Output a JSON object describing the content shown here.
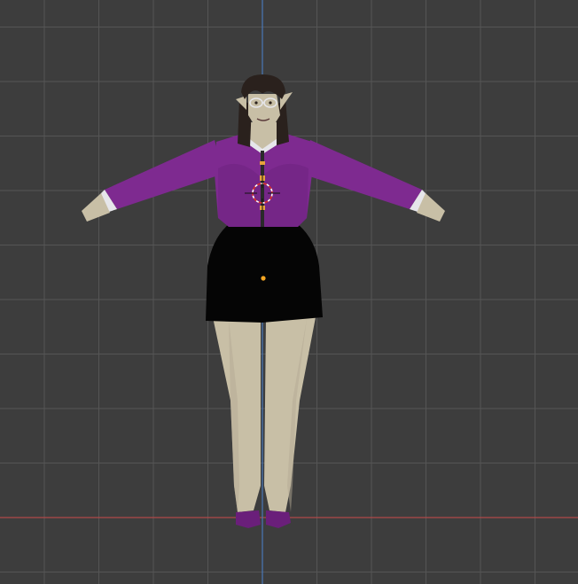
{
  "viewport": {
    "background_color": "#3d3d3d",
    "grid_color": "#555555",
    "x_axis_color": "#b04a4a",
    "z_axis_color": "#4a77b8"
  },
  "model": {
    "skin_color": "#c8bfa6",
    "hair_color": "#2a211d",
    "blouse_color": "#7e2a90",
    "skirt_color": "#050505",
    "shoe_color": "#6a1f7a",
    "cuff_color": "#e6e6ea",
    "button_color": "#e6a23c"
  },
  "gizmos": {
    "cursor_3d": "3d-cursor-icon",
    "object_origin": "object-origin-icon",
    "origin_color": "#f5a623"
  }
}
